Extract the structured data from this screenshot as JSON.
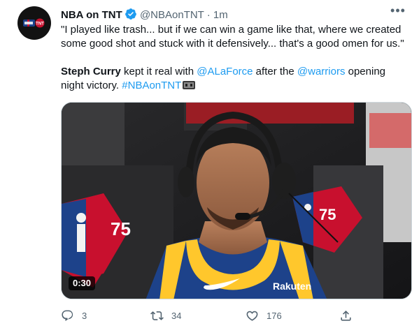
{
  "tweet": {
    "author_name": "NBA on TNT",
    "author_handle": "@NBAonTNT",
    "separator": "·",
    "timestamp": "1m",
    "more_label": "•••",
    "quote": "\"I played like trash... but if we can win a game like that, where we created some good shot and stuck with it defensively... that's a good omen for us.\"",
    "body_bold": "Steph Curry",
    "body_text_1": " kept it real with ",
    "mention_1": "@ALaForce",
    "body_text_2": " after the ",
    "mention_2": "@warriors",
    "body_text_3": " opening night victory. ",
    "hashtag": "#NBAonTNT",
    "hashtag_emoji_icon": "tnt-basketball-emoji-icon",
    "verified_icon": "verified-badge-icon",
    "verified_color": "#1d9bf0"
  },
  "media": {
    "duration": "0:30",
    "jersey_text": "Rakuten",
    "logo_number": "75"
  },
  "actions": {
    "reply_count": "3",
    "retweet_count": "34",
    "like_count": "176",
    "reply_icon": "reply-icon",
    "retweet_icon": "retweet-icon",
    "like_icon": "heart-icon",
    "share_icon": "share-icon"
  },
  "colors": {
    "text": "#0f1419",
    "secondary": "#536471",
    "link": "#1d9bf0",
    "background": "#ffffff"
  }
}
